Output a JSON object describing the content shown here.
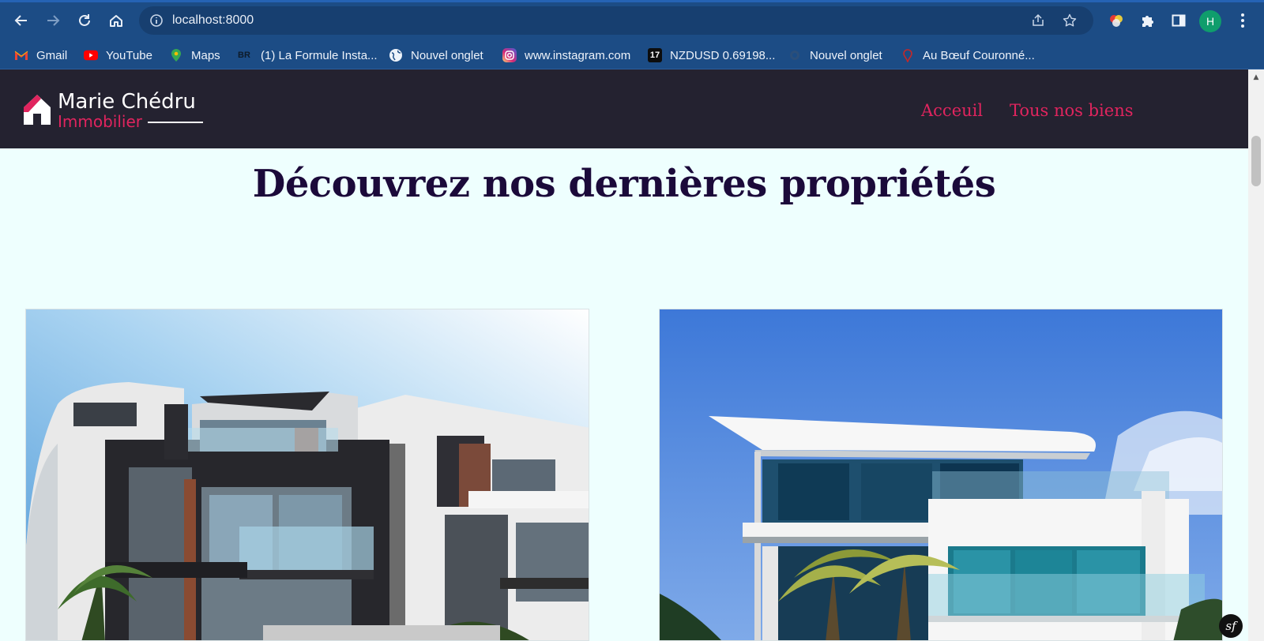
{
  "browser": {
    "url": "localhost:8000",
    "profile_initial": "H",
    "bookmarks": [
      {
        "label": "Gmail",
        "icon": "gmail-icon"
      },
      {
        "label": "YouTube",
        "icon": "youtube-icon"
      },
      {
        "label": "Maps",
        "icon": "maps-icon"
      },
      {
        "label": "(1) La Formule Insta...",
        "icon": "br-icon",
        "icon_text": "BR"
      },
      {
        "label": "Nouvel onglet",
        "icon": "globe-icon"
      },
      {
        "label": "www.instagram.com",
        "icon": "instagram-icon"
      },
      {
        "label": "NZDUSD 0.69198...",
        "icon": "tradingview-icon",
        "icon_text": "17"
      },
      {
        "label": "Nouvel onglet",
        "icon": "globe-icon"
      },
      {
        "label": "Au Bœuf Couronné...",
        "icon": "restaurant-icon"
      }
    ]
  },
  "site": {
    "brand_name": "Marie Chédru",
    "brand_sub": "Immobilier",
    "nav": [
      "Acceuil",
      "Tous nos biens"
    ],
    "page_title": "Découvrez nos dernières propriétés",
    "accent_color": "#e0245e",
    "header_bg": "#242230",
    "page_bg": "#eefffe",
    "debug_badge": "sf"
  }
}
